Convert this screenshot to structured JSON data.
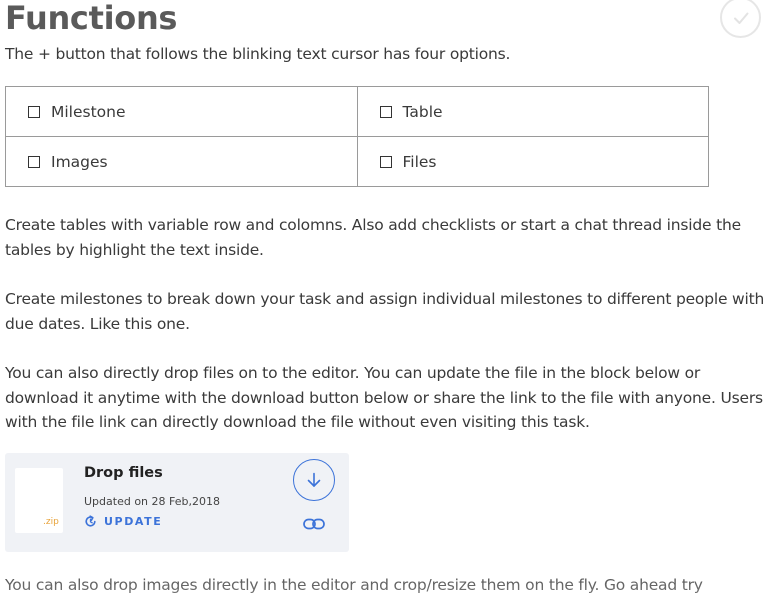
{
  "header": {
    "title": "Functions",
    "complete_icon": "check-circle-icon"
  },
  "intro": "The + button that follows the blinking text cursor has four options.",
  "options": [
    {
      "label": "Milestone"
    },
    {
      "label": "Table"
    },
    {
      "label": "Images"
    },
    {
      "label": "Files"
    }
  ],
  "paragraphs": {
    "tables": "Create tables with variable row and colomns. Also add checklists or start a chat thread inside the tables by highlight the text inside.",
    "milestones": "Create milestones to break down your task and assign individual milestones to different people with due dates. Like this one.",
    "files": "You can also directly drop files on to the editor. You can update the file in the block below or download it anytime with the download button below or share the link to the file with anyone. Users with the file link can directly download the file without even visiting this task.",
    "images": "You can also drop images directly in the editor and crop/resize them on the fly. Go ahead try"
  },
  "file_block": {
    "name": "Drop files",
    "extension": ".zip",
    "updated": "Updated on 28 Feb,2018",
    "update_label": "UPDATE",
    "accent_color": "#3c73d9",
    "extension_color": "#e8a33a",
    "background_color": "#f0f2f6"
  }
}
